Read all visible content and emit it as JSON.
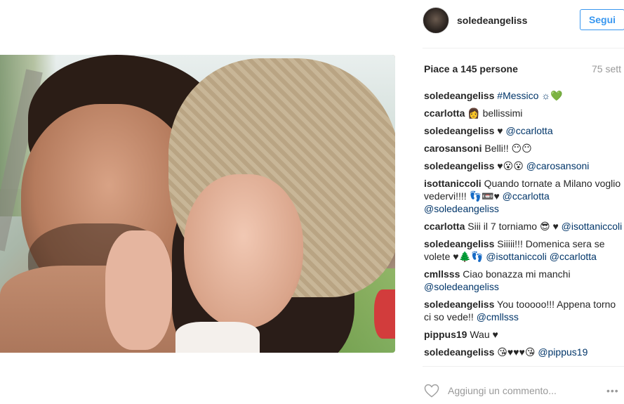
{
  "post": {
    "username": "soledeangeliss",
    "follow_label": "Segui",
    "likes_text": "Piace a 145 persone",
    "time_text": "75 sett",
    "comment_placeholder": "Aggiungi un commento...",
    "more_icon": "•••"
  },
  "comments": [
    {
      "user": "soledeangeliss",
      "text": "",
      "mention": "#Messico ☼💚"
    },
    {
      "user": "ccarlotta",
      "text": "👩 bellissimi",
      "mention": ""
    },
    {
      "user": "soledeangeliss",
      "text": "♥",
      "mention": "@ccarlotta"
    },
    {
      "user": "carosansoni",
      "text": "Belli!! 😶😶",
      "mention": ""
    },
    {
      "user": "soledeangeliss",
      "text": "♥😮😮",
      "mention": "@carosansoni"
    },
    {
      "user": "isottaniccoli",
      "text": "Quando tornate a Milano voglio vedervi!!!! 👣📼♥",
      "mention": "@ccarlotta @soledeangeliss"
    },
    {
      "user": "ccarlotta",
      "text": "Siii il 7 torniamo 😎 ♥",
      "mention": "@isottaniccoli"
    },
    {
      "user": "soledeangeliss",
      "text": "Siiiii!!! Domenica sera se volete ♥🌲👣",
      "mention": "@isottaniccoli @ccarlotta"
    },
    {
      "user": "cmllsss",
      "text": "Ciao bonazza mi manchi",
      "mention": "@soledeangeliss"
    },
    {
      "user": "soledeangeliss",
      "text": "You tooooo!!! Appena torno ci so vede!!",
      "mention": "@cmllsss"
    },
    {
      "user": "pippus19",
      "text": "Wau ♥",
      "mention": ""
    },
    {
      "user": "soledeangeliss",
      "text": "😘♥♥♥😘",
      "mention": "@pippus19"
    }
  ]
}
